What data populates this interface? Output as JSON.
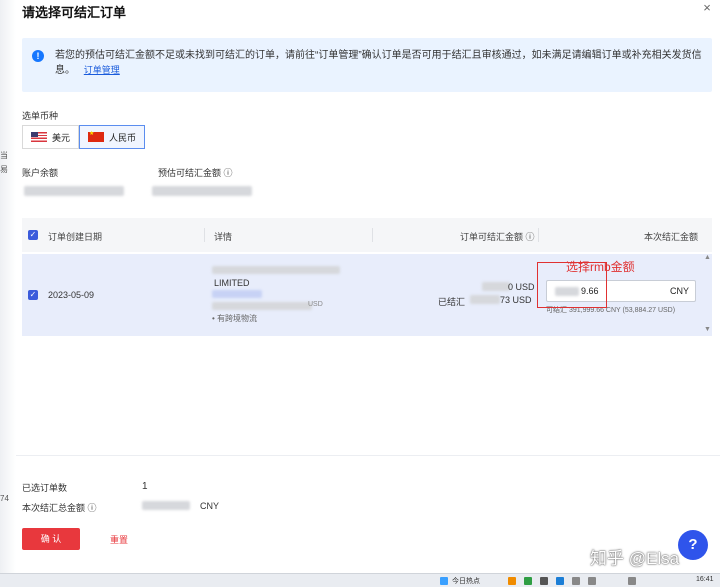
{
  "dialog": {
    "title": "请选择可结汇订单",
    "close_icon": "×"
  },
  "notice": {
    "text": "若您的预估可结汇金额不足或未找到可结汇的订单，请前往“订单管理”确认订单是否可用于结汇且审核通过，如未满足请编辑订单或补充相关发货信息。",
    "link": "订单管理"
  },
  "currency": {
    "label": "选单币种",
    "options": [
      {
        "label": "美元",
        "flag": "us-flag-icon"
      },
      {
        "label": "人民币",
        "flag": "cn-flag-icon",
        "selected": true
      }
    ]
  },
  "balance": {
    "account_label": "账户余额",
    "estimate_label": "预估可结汇金额 ⓘ"
  },
  "table": {
    "headers": [
      "订单创建日期",
      "详情",
      "订单可结汇金额 ⓘ",
      "本次结汇金额"
    ],
    "rows": [
      {
        "date": "2023-05-09",
        "company_fragment": "LIMITED",
        "amount_suffix": "USD",
        "usd_fragment": "USD",
        "logistics": "• 有跨境物流",
        "settled_prefix": "已结汇",
        "settled_suffix": "73  USD",
        "amount_partial": "0  USD",
        "input_value": "9.66",
        "input_currency": "CNY",
        "sub_note": "可结汇 391,999.66  CNY (53,884.27  USD)"
      }
    ]
  },
  "annotation": {
    "text": "选择rmb金额"
  },
  "summary": {
    "selected_label": "已选订单数",
    "selected_count": "1",
    "total_label": "本次结汇总金额 ⓘ",
    "total_currency": "CNY"
  },
  "actions": {
    "confirm": "确 认",
    "reset": "重置"
  },
  "help": "?",
  "watermark": "知乎 @Elsa",
  "taskbar": {
    "time": "16:41",
    "item": "今日热点"
  },
  "side_fragments": [
    "当",
    "易",
    "74"
  ],
  "colors": {
    "primary": "#3b5bdb",
    "danger": "#e8383d",
    "notice_bg": "#eaf3ff",
    "row_selected": "#e8edfb"
  }
}
